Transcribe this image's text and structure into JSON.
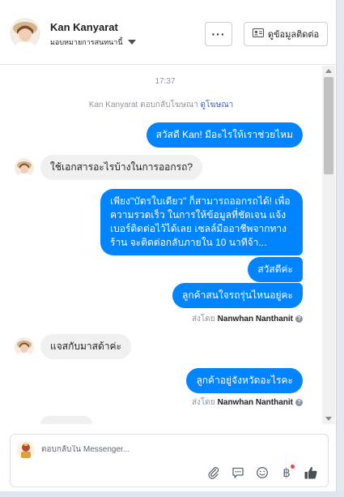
{
  "header": {
    "name": "Kan Kanyarat",
    "assign_label": "มอบหมายการสนทนานี้",
    "more_label": "···",
    "contact_label": "ดูข้อมูลติดต่อ"
  },
  "thread": {
    "time": "17:37",
    "ad_reply_text": "Kan Kanyarat ตอบกลับโฆษณา",
    "ad_reply_link": "ดูโฆษณา",
    "messages": [
      {
        "dir": "out",
        "text": "สวัสดี Kan! มีอะไรให้เราช่วยไหม"
      },
      {
        "dir": "in",
        "text": "ใช้เอกสารอะไรบ้างในการออกรถ?"
      },
      {
        "dir": "out",
        "text": "เพียง\"บัตรใบเดียว\" ก็สามารถออกรถได้! เพื่อความรวดเร็ว ในการให้ข้อมูลที่ชัดเจน แจ้งเบอร์ติดต่อไว้ได้เลย เซลล์มืออาชีพจากทางร้าน จะติดต่อกลับภายใน 10 นาทีจ้า..."
      },
      {
        "dir": "out",
        "text": "สวัสดีค่ะ"
      },
      {
        "dir": "out",
        "text": "ลูกค้าสนใจรถรุ่นไหนอยู่คะ"
      },
      {
        "dir": "in",
        "text": "แจสกับมาสด้าค่ะ"
      },
      {
        "dir": "out",
        "text": "ลูกค้าอยู่จังหวัดอะไรคะ"
      }
    ],
    "sent_by_prefix": "ส่งโดย",
    "sent_by_name": "Nanwhan Nanthanit",
    "help_glyph": "?"
  },
  "composer": {
    "placeholder": "ตอบกลับใน Messenger..."
  },
  "icons": {
    "attach": "paperclip-icon",
    "quick_reply": "speech-bubble-icon",
    "emoji": "smile-icon",
    "payment": "baht-icon",
    "like": "thumbs-up-icon"
  },
  "colors": {
    "accent": "#0084ff",
    "incoming_bubble": "#f0f0f0",
    "link": "#4267b2",
    "notification": "#fa3e3e"
  }
}
